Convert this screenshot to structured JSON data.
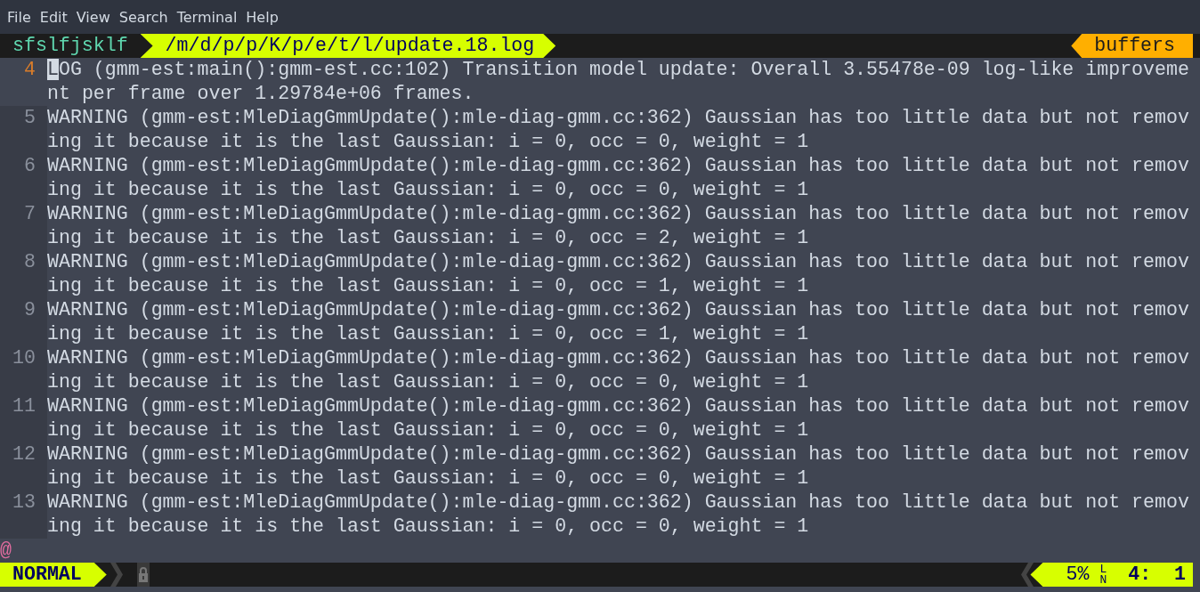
{
  "menu": [
    "File",
    "Edit",
    "View",
    "Search",
    "Terminal",
    "Help"
  ],
  "tabline": {
    "session": "sfslfjsklf",
    "path": "/m/d/p/p/K/p/e/t/l/update.18.log",
    "buffers": "buffers"
  },
  "lines": [
    {
      "number": "4",
      "current": true,
      "cursor": "L",
      "rows": [
        "OG (gmm-est:main():gmm-est.cc:102) Transition model update: Overall 3.55478e-09 log-like improveme",
        "nt per frame over 1.29784e+06 frames."
      ]
    },
    {
      "number": "5",
      "current": false,
      "rows": [
        "WARNING (gmm-est:MleDiagGmmUpdate():mle-diag-gmm.cc:362) Gaussian has too little data but not remov",
        "ing it because it is the last Gaussian: i = 0, occ = 0, weight = 1"
      ]
    },
    {
      "number": "6",
      "current": false,
      "rows": [
        "WARNING (gmm-est:MleDiagGmmUpdate():mle-diag-gmm.cc:362) Gaussian has too little data but not remov",
        "ing it because it is the last Gaussian: i = 0, occ = 0, weight = 1"
      ]
    },
    {
      "number": "7",
      "current": false,
      "rows": [
        "WARNING (gmm-est:MleDiagGmmUpdate():mle-diag-gmm.cc:362) Gaussian has too little data but not remov",
        "ing it because it is the last Gaussian: i = 0, occ = 2, weight = 1"
      ]
    },
    {
      "number": "8",
      "current": false,
      "rows": [
        "WARNING (gmm-est:MleDiagGmmUpdate():mle-diag-gmm.cc:362) Gaussian has too little data but not remov",
        "ing it because it is the last Gaussian: i = 0, occ = 1, weight = 1"
      ]
    },
    {
      "number": "9",
      "current": false,
      "rows": [
        "WARNING (gmm-est:MleDiagGmmUpdate():mle-diag-gmm.cc:362) Gaussian has too little data but not remov",
        "ing it because it is the last Gaussian: i = 0, occ = 1, weight = 1"
      ]
    },
    {
      "number": "10",
      "current": false,
      "rows": [
        "WARNING (gmm-est:MleDiagGmmUpdate():mle-diag-gmm.cc:362) Gaussian has too little data but not remov",
        "ing it because it is the last Gaussian: i = 0, occ = 0, weight = 1"
      ]
    },
    {
      "number": "11",
      "current": false,
      "rows": [
        "WARNING (gmm-est:MleDiagGmmUpdate():mle-diag-gmm.cc:362) Gaussian has too little data but not remov",
        "ing it because it is the last Gaussian: i = 0, occ = 0, weight = 1"
      ]
    },
    {
      "number": "12",
      "current": false,
      "rows": [
        "WARNING (gmm-est:MleDiagGmmUpdate():mle-diag-gmm.cc:362) Gaussian has too little data but not remov",
        "ing it because it is the last Gaussian: i = 0, occ = 0, weight = 1"
      ]
    },
    {
      "number": "13",
      "current": false,
      "rows": [
        "WARNING (gmm-est:MleDiagGmmUpdate():mle-diag-gmm.cc:362) Gaussian has too little data but not remov",
        "ing it because it is the last Gaussian: i = 0, occ = 0, weight = 1"
      ]
    }
  ],
  "overflow_marker": "@",
  "statusline": {
    "mode": "NORMAL",
    "percent": "5%",
    "ln_top": "L",
    "ln_bottom": "N",
    "position": "4:  1"
  }
}
